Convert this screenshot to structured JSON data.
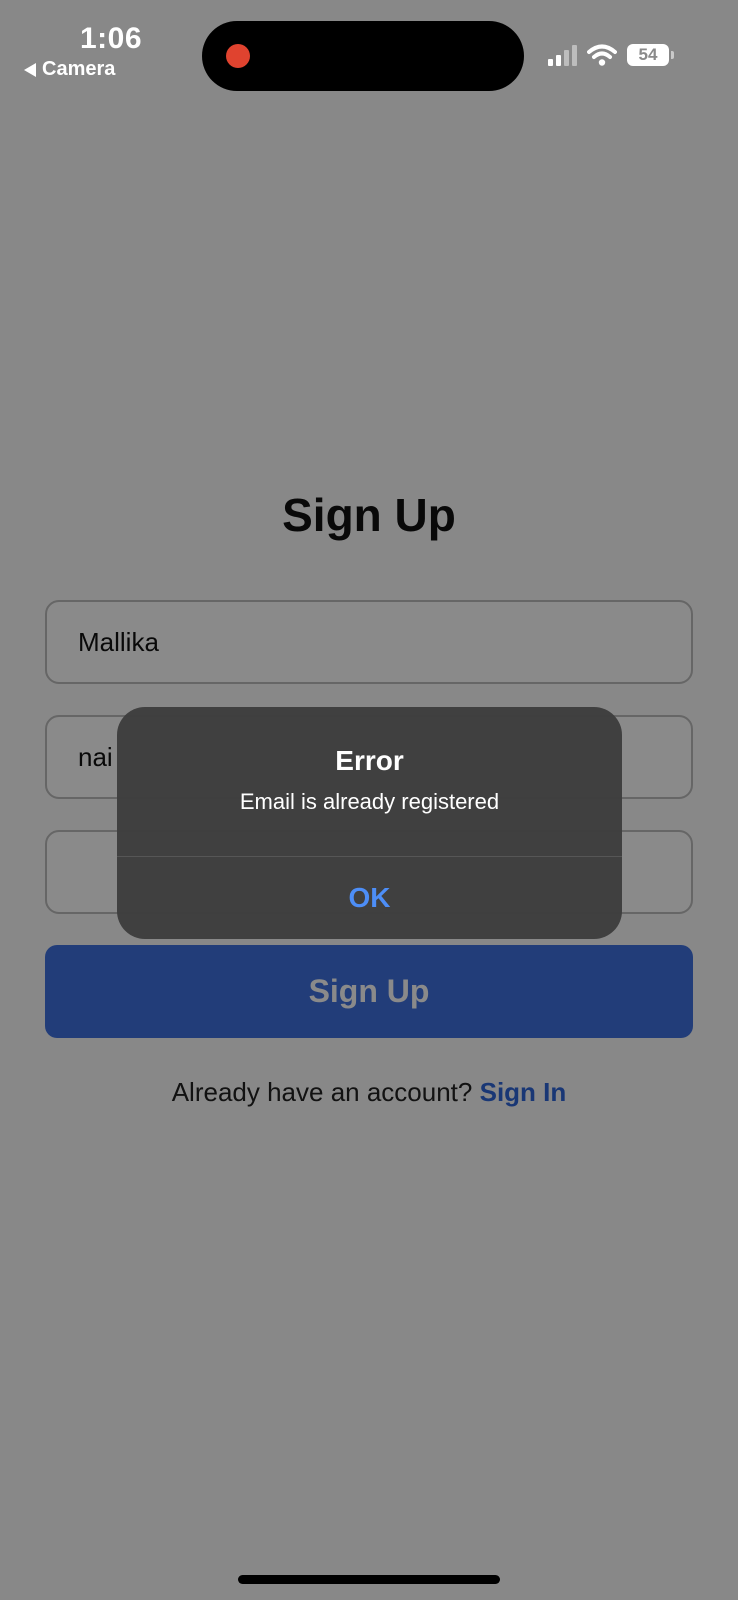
{
  "status_bar": {
    "time": "1:06",
    "back_label": "Camera",
    "battery": "54",
    "icons": [
      "recording-dot-icon",
      "signal-icon",
      "wifi-icon",
      "battery-icon"
    ]
  },
  "form": {
    "title": "Sign Up",
    "name_value": "Mallika",
    "email_value": "nai",
    "password_value": "",
    "submit_label": "Sign Up",
    "footer_text": "Already have an account?",
    "footer_link": "Sign In"
  },
  "alert": {
    "title": "Error",
    "message": "Email is already registered",
    "ok_label": "OK"
  },
  "colors": {
    "primary": "#3f72e0",
    "link": "#2f66d9",
    "alert_button": "#4d8ef7",
    "recording": "#e0432f"
  }
}
